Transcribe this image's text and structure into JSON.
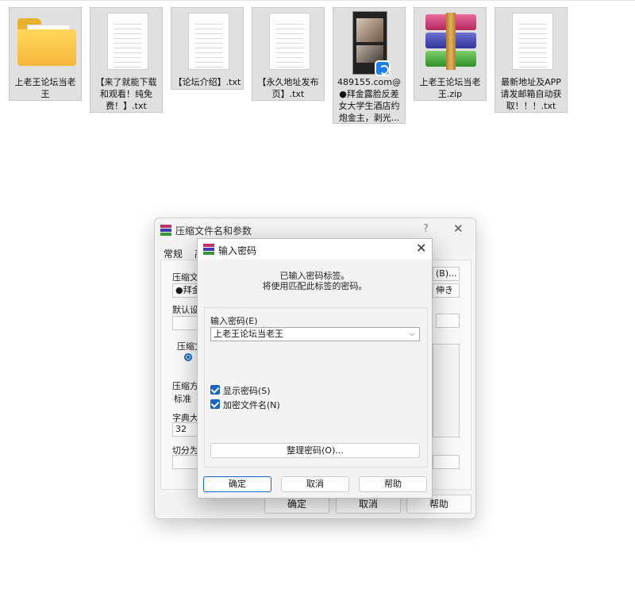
{
  "files": [
    {
      "label": "上老王论坛当老王",
      "icon": "folder-icon"
    },
    {
      "label": "【来了就能下载和观看！纯免费！】.txt",
      "icon": "text-file-icon"
    },
    {
      "label": "【论坛介绍】.txt",
      "icon": "text-file-icon"
    },
    {
      "label": "【永久地址发布页】.txt",
      "icon": "text-file-icon"
    },
    {
      "label": "489155.com@●拜金露脸反差女大学生酒店约炮金主，剥光...",
      "icon": "video-file-icon"
    },
    {
      "label": "上老王论坛当老王.zip",
      "icon": "winrar-archive-icon"
    },
    {
      "label": "最新地址及APP请发邮箱自动获取！！！.txt",
      "icon": "text-file-icon"
    }
  ],
  "archive_window": {
    "title": "压缩文件名和参数",
    "help_glyph": "?",
    "close_glyph": "✕",
    "tab_general": "常规",
    "tab_advanced_partial": "高",
    "filename_label": "压缩文件",
    "filename_value": "●拜金",
    "browse_button": "(B)...",
    "update_mode_partial": "伸き",
    "default_settings_label": "默认设置",
    "format_label": "压缩文",
    "method_label": "压缩方式",
    "method_value": "标准",
    "dict_label": "字典大小",
    "dict_value": "32",
    "split_label": "切分为分",
    "ok_button": "确定",
    "cancel_button": "取消",
    "help_button": "帮助"
  },
  "password_dialog": {
    "title": "输入密码",
    "close_glyph": "✕",
    "message_line1": "已输入密码标签。",
    "message_line2": "将使用匹配此标签的密码。",
    "password_label": "输入密码(E)",
    "password_value": "上老王论坛当老王",
    "show_password_label": "显示密码(S)",
    "show_password_checked": true,
    "encrypt_filenames_label": "加密文件名(N)",
    "encrypt_filenames_checked": true,
    "organize_button": "整理密码(O)...",
    "ok_button": "确定",
    "cancel_button": "取消",
    "help_button": "帮助"
  },
  "colors": {
    "accent": "#1467c7",
    "tile_bg": "#e0e0e0"
  }
}
